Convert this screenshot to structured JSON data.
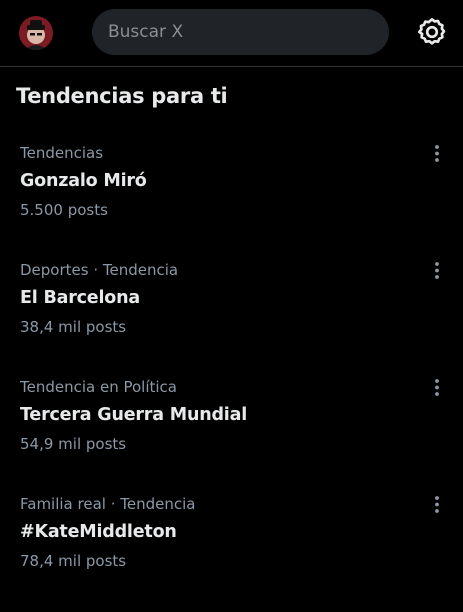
{
  "header": {
    "search_placeholder": "Buscar X",
    "avatar_icon": "profile-avatar",
    "settings_icon": "gear-icon"
  },
  "section": {
    "title": "Tendencias para ti"
  },
  "trends": [
    {
      "meta": "Tendencias",
      "name": "Gonzalo Miró",
      "count": "5.500 posts"
    },
    {
      "meta": "Deportes · Tendencia",
      "name": "El Barcelona",
      "count": "38,4 mil posts"
    },
    {
      "meta": "Tendencia en Política",
      "name": "Tercera Guerra Mundial",
      "count": "54,9 mil posts"
    },
    {
      "meta": "Familia real · Tendencia",
      "name": "#KateMiddleton",
      "count": "78,4 mil posts"
    }
  ],
  "colors": {
    "background": "#000000",
    "primary_text": "#e7e9ea",
    "secondary_text": "#8b98a5",
    "search_bg": "#202327"
  }
}
